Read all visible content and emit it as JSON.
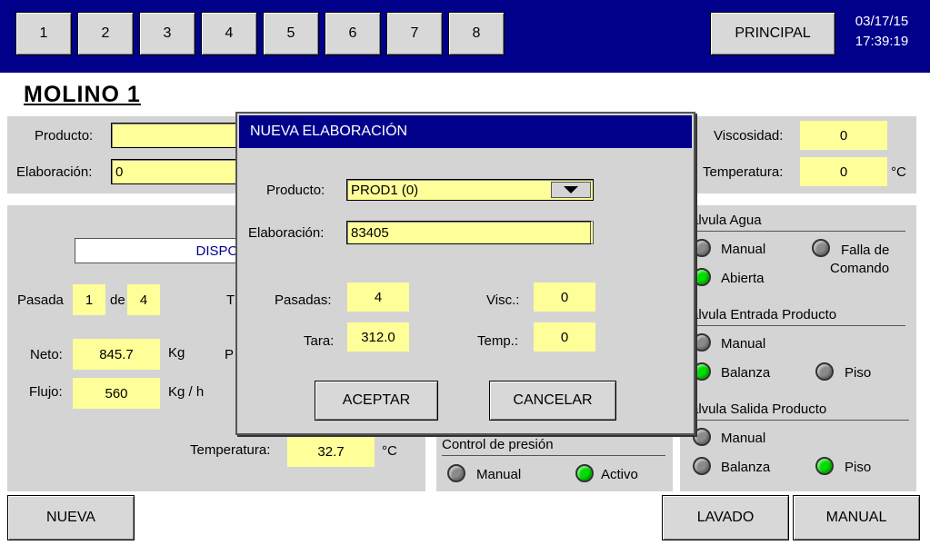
{
  "topbar": {
    "num_buttons": [
      "1",
      "2",
      "3",
      "4",
      "5",
      "6",
      "7",
      "8"
    ],
    "principal_label": "PRINCIPAL",
    "date": "03/17/15",
    "time": "17:39:19",
    "bg_color": "#00008b"
  },
  "title": "MOLINO 1",
  "header_panel": {
    "producto_label": "Producto:",
    "producto_value": "",
    "elaboracion_label": "Elaboración:",
    "elaboracion_value": "0",
    "viscosidad_label": "Viscosidad:",
    "viscosidad_value": "0",
    "temperatura_label": "Temperatura:",
    "temperatura_value": "0",
    "temperatura_unit": "°C"
  },
  "main_panel": {
    "status": "DISPON",
    "pasada_label": "Pasada",
    "pasada_value": "1",
    "de_label": "de",
    "de_value": "4",
    "t_label": "T",
    "neto_label": "Neto:",
    "neto_value": "845.7",
    "neto_unit": "Kg",
    "p_label": "P",
    "flujo_label": "Flujo:",
    "flujo_value": "560",
    "flujo_unit": "Kg / h",
    "temperatura_label": "Temperatura:",
    "temperatura_value": "32.7",
    "temperatura_unit": "°C"
  },
  "presion_panel": {
    "title": "Control de presión",
    "manual_label": "Manual",
    "activo_label": "Activo"
  },
  "valves": {
    "agua": {
      "title": "álvula Agua",
      "manual": "Manual",
      "abierta": "Abierta",
      "falla_line1": "Falla de",
      "falla_line2": "Comando"
    },
    "entrada": {
      "title": "álvula Entrada Producto",
      "manual": "Manual",
      "balanza": "Balanza",
      "piso": "Piso"
    },
    "salida": {
      "title": "álvula Salida Producto",
      "manual": "Manual",
      "balanza": "Balanza",
      "piso": "Piso"
    },
    "led_on_color": "#00dd00",
    "led_off_color": "#8a8a8a"
  },
  "bottom": {
    "nueva": "NUEVA",
    "lavado": "LAVADO",
    "manual": "MANUAL"
  },
  "dialog": {
    "title": "NUEVA ELABORACIÓN",
    "producto_label": "Producto:",
    "producto_value": "PROD1 (0)",
    "elaboracion_label": "Elaboración:",
    "elaboracion_value": "83405",
    "pasadas_label": "Pasadas:",
    "pasadas_value": "4",
    "tara_label": "Tara:",
    "tara_value": "312.0",
    "visc_label": "Visc.:",
    "visc_value": "0",
    "temp_label": "Temp.:",
    "temp_value": "0",
    "aceptar": "ACEPTAR",
    "cancelar": "CANCELAR"
  }
}
